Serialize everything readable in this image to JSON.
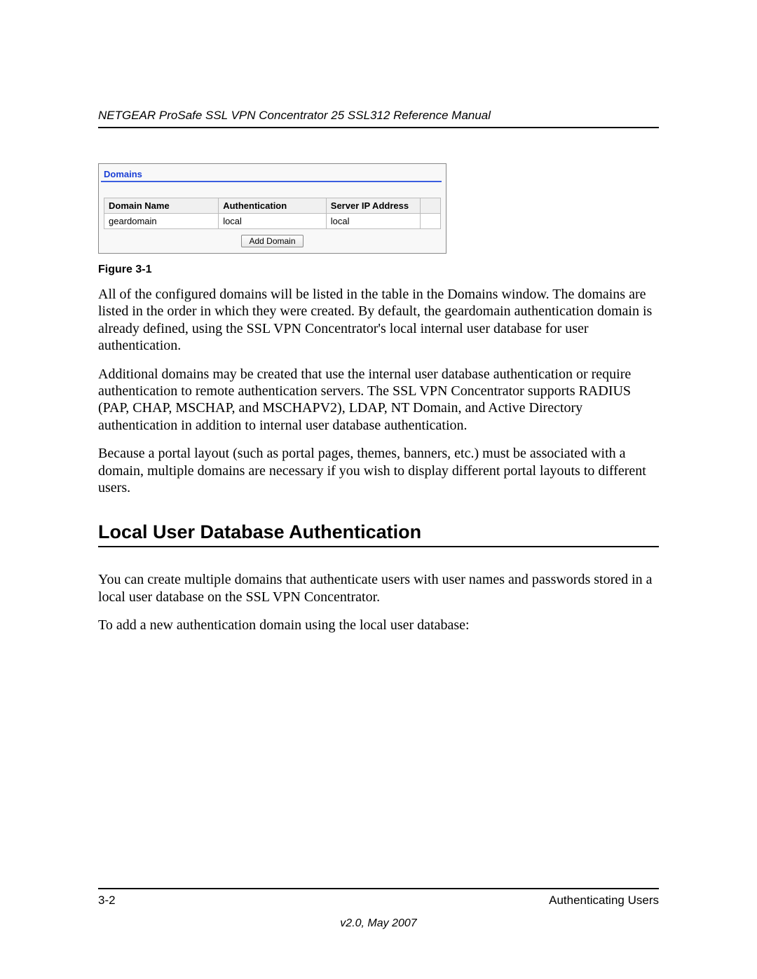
{
  "header": {
    "title": "NETGEAR ProSafe SSL VPN Concentrator 25 SSL312 Reference Manual"
  },
  "domainsPanel": {
    "title": "Domains",
    "columns": [
      "Domain Name",
      "Authentication",
      "Server IP Address"
    ],
    "rows": [
      {
        "name": "geardomain",
        "auth": "local",
        "ip": "local"
      }
    ],
    "addButton": "Add Domain"
  },
  "figureLabel": "Figure 3-1",
  "paragraphs": {
    "p1": "All of the configured domains will be listed in the table in the Domains window. The domains are listed in the order in which they were created. By default, the geardomain authentication domain is already defined, using the SSL VPN Concentrator's local internal user database for user authentication.",
    "p2": "Additional domains may be created that use the internal user database authentication or require authentication to remote authentication servers. The SSL VPN Concentrator supports RADIUS (PAP, CHAP, MSCHAP, and MSCHAPV2), LDAP, NT Domain, and Active Directory authentication in addition to internal user database authentication.",
    "p3": "Because a portal layout (such as portal pages, themes, banners, etc.) must be associated with a domain, multiple domains are necessary if you wish to display different portal layouts to different users.",
    "p4": "You can create multiple domains that authenticate users with user names and passwords stored in a local user database on the SSL VPN Concentrator.",
    "p5": "To add a new authentication domain using the local user database:"
  },
  "sectionHeading": "Local User Database Authentication",
  "footer": {
    "pageNumber": "3-2",
    "chapter": "Authenticating Users",
    "version": "v2.0, May 2007"
  }
}
